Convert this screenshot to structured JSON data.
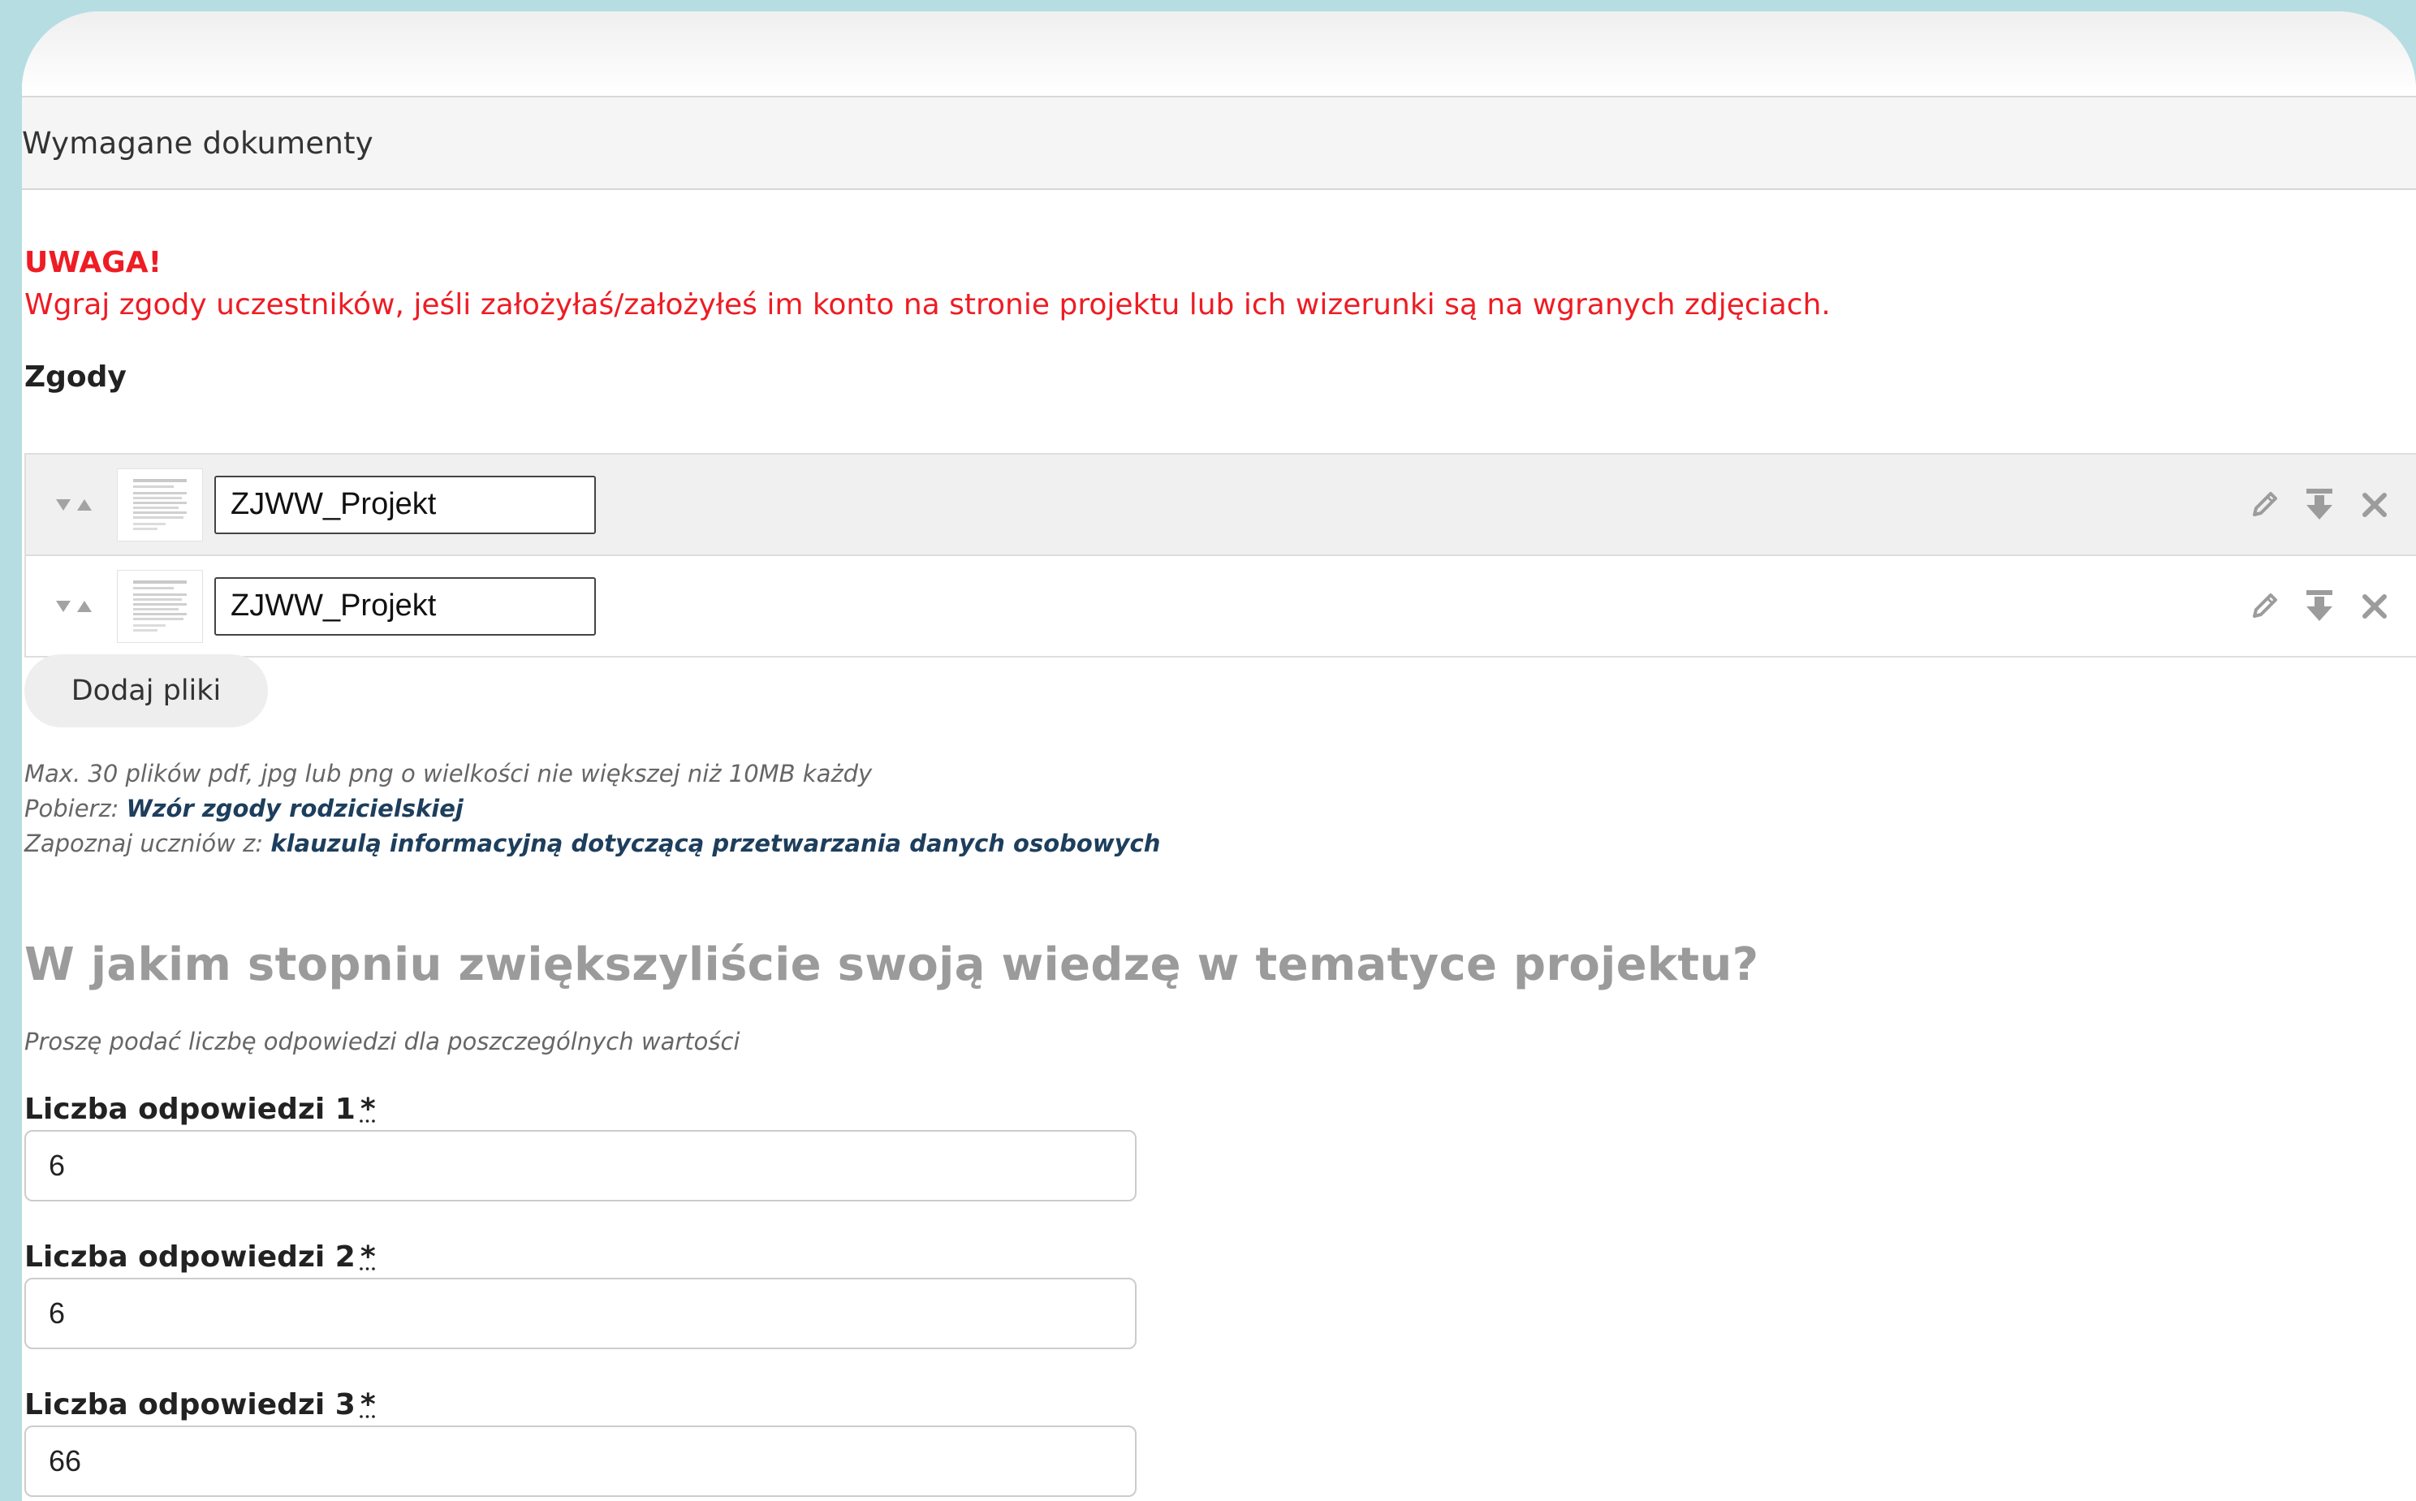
{
  "section": {
    "title": "Wymagane dokumenty"
  },
  "warning": {
    "title": "UWAGA!",
    "text": "Wgraj zgody uczestników, jeśli założyłaś/założyłeś im konto na stronie projektu lub ich wizerunki są na wgranych zdjęciach."
  },
  "consents": {
    "label": "Zgody",
    "files": [
      {
        "name": "ZJWW_Projekt"
      },
      {
        "name": "ZJWW_Projekt"
      }
    ],
    "add_button": "Dodaj pliki"
  },
  "help": {
    "limits": "Max. 30 plików pdf, jpg lub png o wielkości nie większej niż 10MB każdy",
    "download_prefix": "Pobierz:",
    "download_link": "Wzór zgody rodzicielskiej",
    "inform_prefix": "Zapoznaj uczniów z:",
    "inform_link": "klauzulą informacyjną dotyczącą przetwarzania danych osobowych"
  },
  "question": {
    "title": "W jakim stopniu zwiększyliście swoją wiedzę w tematyce projektu?",
    "hint": "Proszę podać liczbę odpowiedzi dla poszczególnych wartości"
  },
  "fields": [
    {
      "label": "Liczba odpowiedzi 1",
      "required": "*",
      "value": "6"
    },
    {
      "label": "Liczba odpowiedzi 2",
      "required": "*",
      "value": "6"
    },
    {
      "label": "Liczba odpowiedzi 3",
      "required": "*",
      "value": "66"
    }
  ],
  "icons": {
    "sort": "sort-arrows-icon",
    "edit": "pencil-icon",
    "download": "download-icon",
    "remove": "close-icon"
  },
  "colors": {
    "background": "#b6dde2",
    "warning": "#ee1c24",
    "link": "#1d3e5c",
    "question": "#9b9b9b"
  }
}
